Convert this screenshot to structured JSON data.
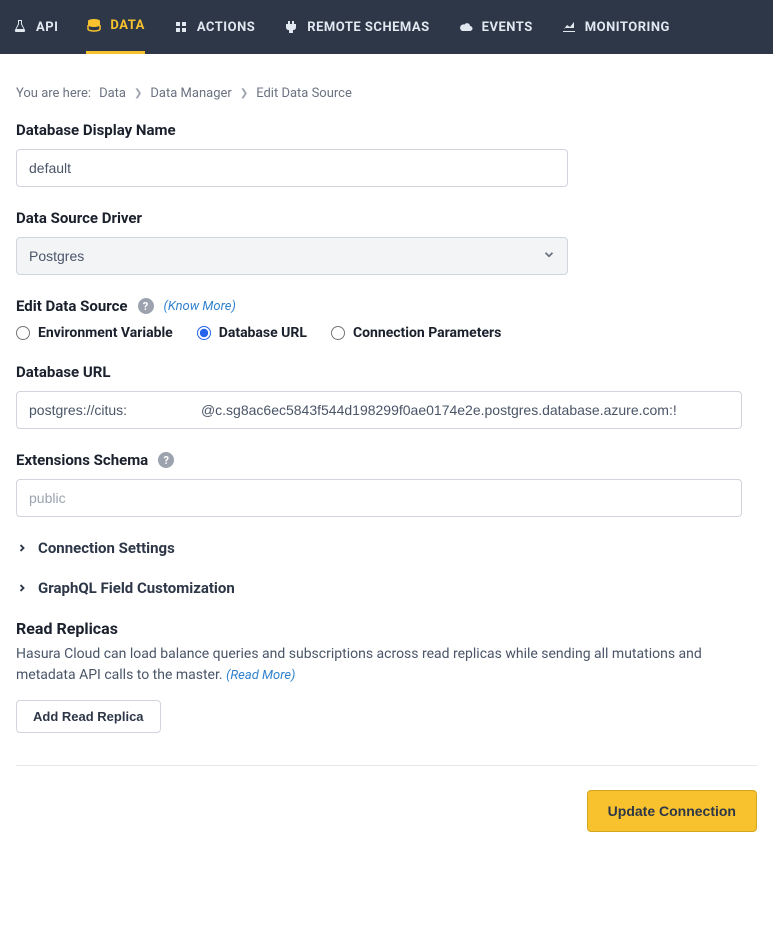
{
  "nav": {
    "api": "API",
    "data": "DATA",
    "actions": "ACTIONS",
    "remote_schemas": "REMOTE SCHEMAS",
    "events": "EVENTS",
    "monitoring": "MONITORING"
  },
  "breadcrumb": {
    "prefix": "You are here:",
    "items": [
      "Data",
      "Data Manager",
      "Edit Data Source"
    ]
  },
  "form": {
    "display_name_label": "Database Display Name",
    "display_name_value": "default",
    "driver_label": "Data Source Driver",
    "driver_value": "Postgres",
    "edit_source_label": "Edit Data Source",
    "know_more": "(Know More)",
    "radio_env": "Environment Variable",
    "radio_url": "Database URL",
    "radio_params": "Connection Parameters",
    "db_url_label": "Database URL",
    "db_url_value": "postgres://citus:                   @c.sg8ac6ec5843f544d198299f0ae0174e2e.postgres.database.azure.com:!",
    "ext_schema_label": "Extensions Schema",
    "ext_schema_placeholder": "public",
    "connection_settings": "Connection Settings",
    "graphql_custom": "GraphQL Field Customization",
    "read_replicas_title": "Read Replicas",
    "read_replicas_desc": "Hasura Cloud can load balance queries and subscriptions across read replicas while sending all mutations and metadata API calls to the master. ",
    "read_more": "(Read More)",
    "add_replica_btn": "Add Read Replica",
    "update_btn": "Update Connection"
  }
}
